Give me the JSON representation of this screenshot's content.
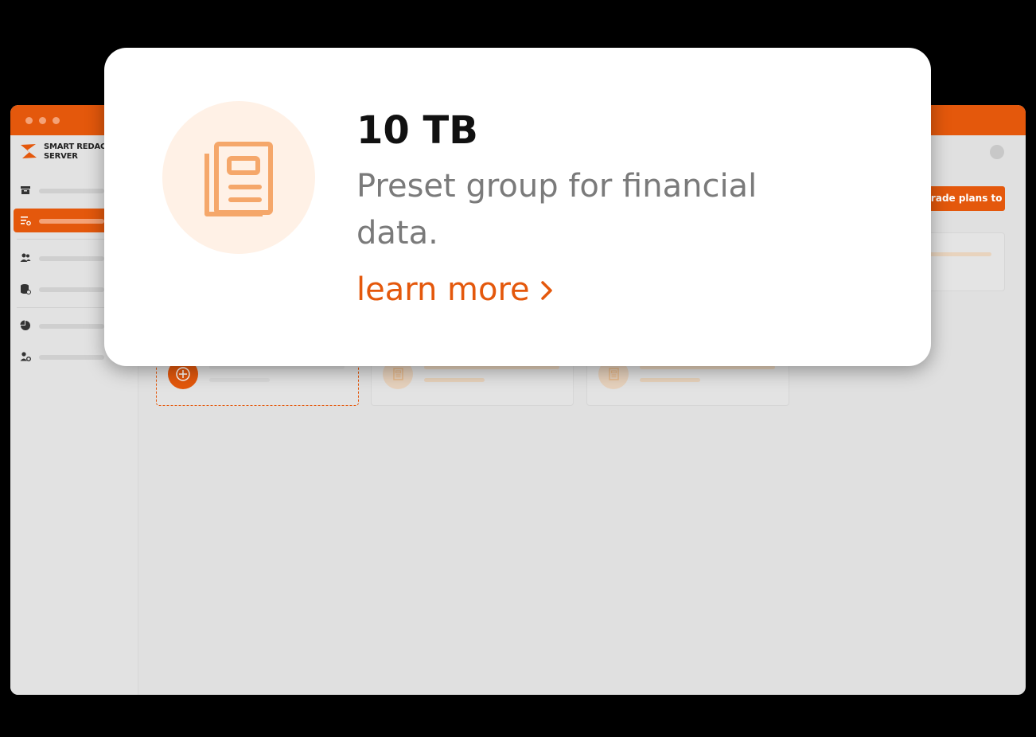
{
  "app": {
    "name": "SMART REDACT\nSERVER"
  },
  "toolbar": {
    "cta_label": "Upgrade plans to get more"
  },
  "sidebar": {
    "items": [
      {
        "icon": "archive-icon",
        "active": false
      },
      {
        "icon": "preset-list-icon",
        "active": true
      },
      {
        "icon": "users-icon",
        "active": false
      },
      {
        "icon": "database-icon",
        "active": false
      },
      {
        "icon": "pie-chart-icon",
        "active": false
      },
      {
        "icon": "user-settings-icon",
        "active": false
      }
    ]
  },
  "popup": {
    "icon": "document-icon",
    "title": "10 TB",
    "description": "Preset group for financial data.",
    "link_label": "learn more",
    "link_icon": "chevron-right-icon"
  },
  "colors": {
    "accent": "#e4580c",
    "accent_light": "#f4a277",
    "icon_bg": "#fff1e6"
  }
}
